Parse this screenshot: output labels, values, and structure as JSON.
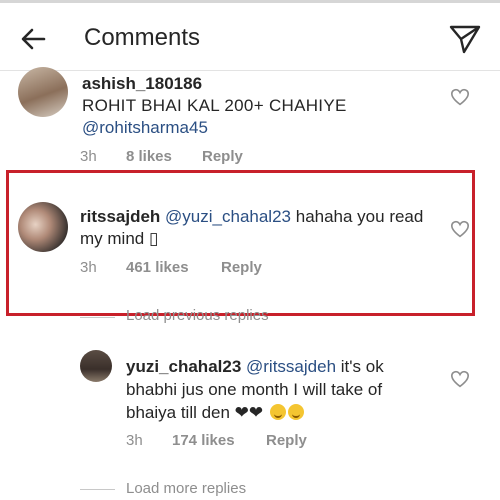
{
  "header": {
    "title": "Comments",
    "back_icon": "arrow-left-icon",
    "send_icon": "paper-plane-icon"
  },
  "comments": [
    {
      "username": "ashish_180186",
      "text": "ROHIT BHAI KAL 200+ CHAHIYE",
      "mention": "@rohitsharma45",
      "time": "3h",
      "likes": "8 likes",
      "reply_label": "Reply"
    },
    {
      "username": "ritssajdeh",
      "mention": "@yuzi_chahal23",
      "text": "hahaha you read my mind",
      "trailing_glyph": "▯",
      "time": "3h",
      "likes": "461 likes",
      "reply_label": "Reply"
    },
    {
      "username": "yuzi_chahal23",
      "mention": "@ritssajdeh",
      "text_line1": "it's ok",
      "text_line2": "bhabhi jus one month I will take of",
      "text_line3": "bhaiya till den ❤❤",
      "time": "3h",
      "likes": "174 likes",
      "reply_label": "Reply"
    }
  ],
  "load_previous_label": "Load previous replies",
  "load_more_label": "Load more replies",
  "colors": {
    "highlight_border": "#c8202a",
    "mention": "#2b4f83",
    "meta_gray": "#8e8e8e"
  }
}
